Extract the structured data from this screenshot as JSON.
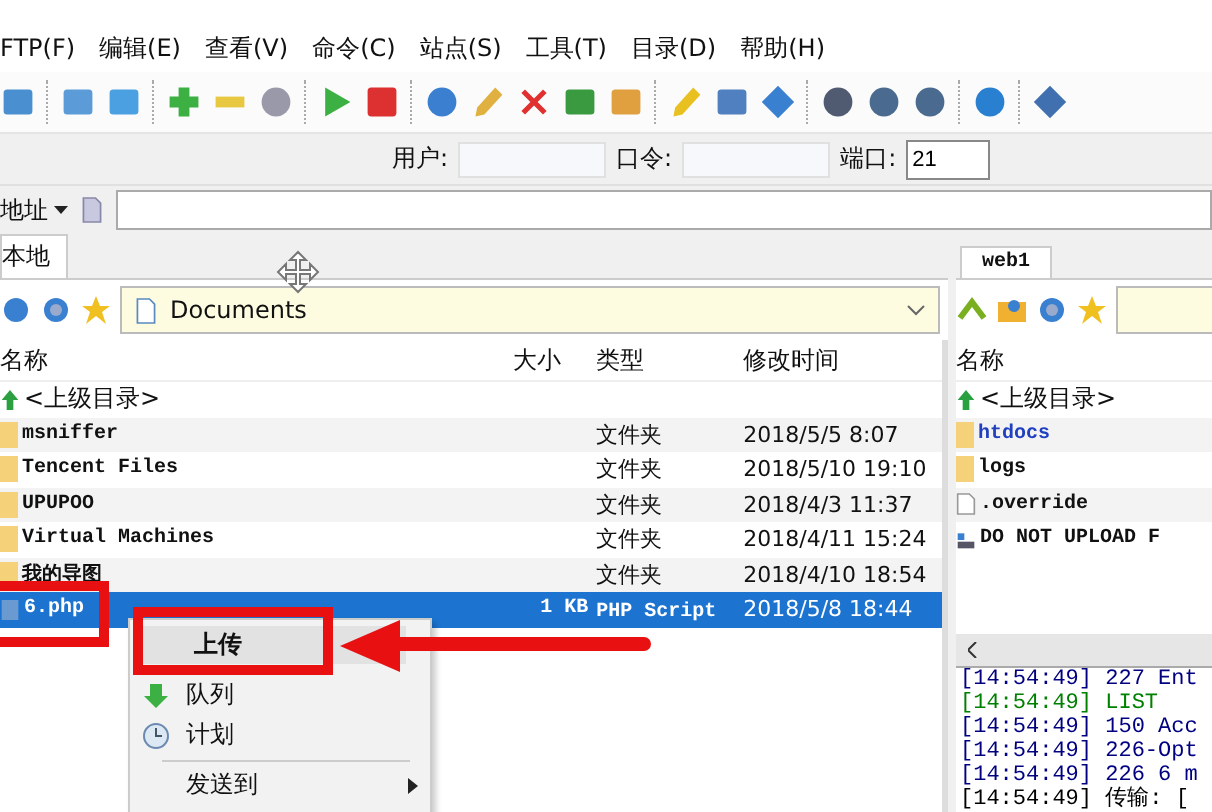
{
  "menu_bar": [
    "FTP(F)",
    "编辑(E)",
    "查看(V)",
    "命令(C)",
    "站点(S)",
    "工具(T)",
    "目录(D)",
    "帮助(H)"
  ],
  "login": {
    "user_label": "用户:",
    "password_label": "口令:",
    "port_label": "端口:",
    "port_value": "21"
  },
  "address": {
    "label": "地址"
  },
  "local": {
    "tab": "本地",
    "path": "Documents",
    "columns": [
      "名称",
      "大小",
      "类型",
      "修改时间"
    ],
    "rows": [
      {
        "kind": "up",
        "name": "<上级目录>",
        "size": "",
        "type": "",
        "modified": "",
        "selected": false
      },
      {
        "kind": "folder",
        "name": "msniffer",
        "size": "",
        "type": "文件夹",
        "modified": "2018/5/5 8:07",
        "selected": false
      },
      {
        "kind": "folder",
        "name": "Tencent Files",
        "size": "",
        "type": "文件夹",
        "modified": "2018/5/10 19:10",
        "selected": false
      },
      {
        "kind": "folder",
        "name": "UPUPOO",
        "size": "",
        "type": "文件夹",
        "modified": "2018/4/3 11:37",
        "selected": false
      },
      {
        "kind": "folder",
        "name": "Virtual Machines",
        "size": "",
        "type": "文件夹",
        "modified": "2018/4/11 15:24",
        "selected": false
      },
      {
        "kind": "folder",
        "name": "我的导图",
        "size": "",
        "type": "文件夹",
        "modified": "2018/4/10 18:54",
        "selected": false
      },
      {
        "kind": "file",
        "name": "6.php",
        "size": "1 KB",
        "type": "PHP Script",
        "modified": "2018/5/8 18:44",
        "selected": true
      }
    ]
  },
  "remote": {
    "tab": "web1",
    "column": "名称",
    "rows": [
      {
        "kind": "up",
        "name": "<上级目录>"
      },
      {
        "kind": "folder",
        "name": "htdocs"
      },
      {
        "kind": "folder",
        "name": "logs"
      },
      {
        "kind": "file",
        "name": ".override"
      },
      {
        "kind": "link",
        "name": "DO NOT UPLOAD F"
      }
    ],
    "log": [
      {
        "time": "[14:54:49]",
        "message": "227 Ent",
        "color": "#000080"
      },
      {
        "time": "[14:54:49]",
        "message": "LIST",
        "color": "#008000"
      },
      {
        "time": "[14:54:49]",
        "message": "150 Acc",
        "color": "#000080"
      },
      {
        "time": "[14:54:49]",
        "message": "226-Opt",
        "color": "#000080"
      },
      {
        "time": "[14:54:49]",
        "message": "226 6 m",
        "color": "#000080"
      },
      {
        "time": "[14:54:49]",
        "message": "传输: [",
        "color": "#000000"
      }
    ]
  },
  "context_menu": {
    "items": [
      {
        "kind": "item",
        "label": "上传",
        "selected": true,
        "submenu": false
      },
      {
        "kind": "item",
        "label": "队列",
        "selected": false,
        "submenu": false
      },
      {
        "kind": "item",
        "label": "计划",
        "selected": false,
        "submenu": false
      },
      {
        "kind": "separator"
      },
      {
        "kind": "item",
        "label": "发送到",
        "selected": false,
        "submenu": true
      }
    ]
  }
}
